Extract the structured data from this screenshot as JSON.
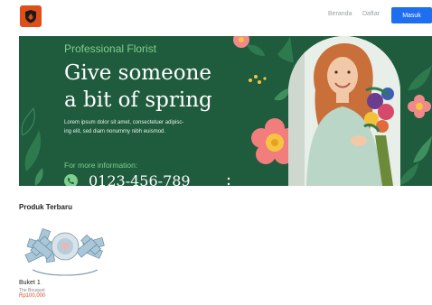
{
  "navbar": {
    "logo_icon": "flower-shield-icon",
    "links": [
      "Beranda",
      "Daftar"
    ],
    "login_label": "Masuk"
  },
  "hero": {
    "subtitle": "Professional Florist",
    "title_line1": "Give someone",
    "title_line2": "a bit of spring",
    "body_line1": "Lorem ipsum dolor sit amet, consectetuer adipisc-",
    "body_line2": "ing elit, sed diam nonummy nibh euismod.",
    "more_info": "For more information:",
    "phone": "0123-456-789",
    "colors": {
      "background": "#1f5b3d",
      "accent": "#7fcf8c"
    }
  },
  "products": {
    "section_title": "Produk Terbaru",
    "items": [
      {
        "name": "Buket 1",
        "category": "The Bouquet",
        "price": "Rp100,000",
        "image_icon": "money-bouquet-image"
      }
    ]
  },
  "colors": {
    "primary": "#1e6ff0",
    "logo": "#e04e1a",
    "price": "#e24a2c"
  }
}
